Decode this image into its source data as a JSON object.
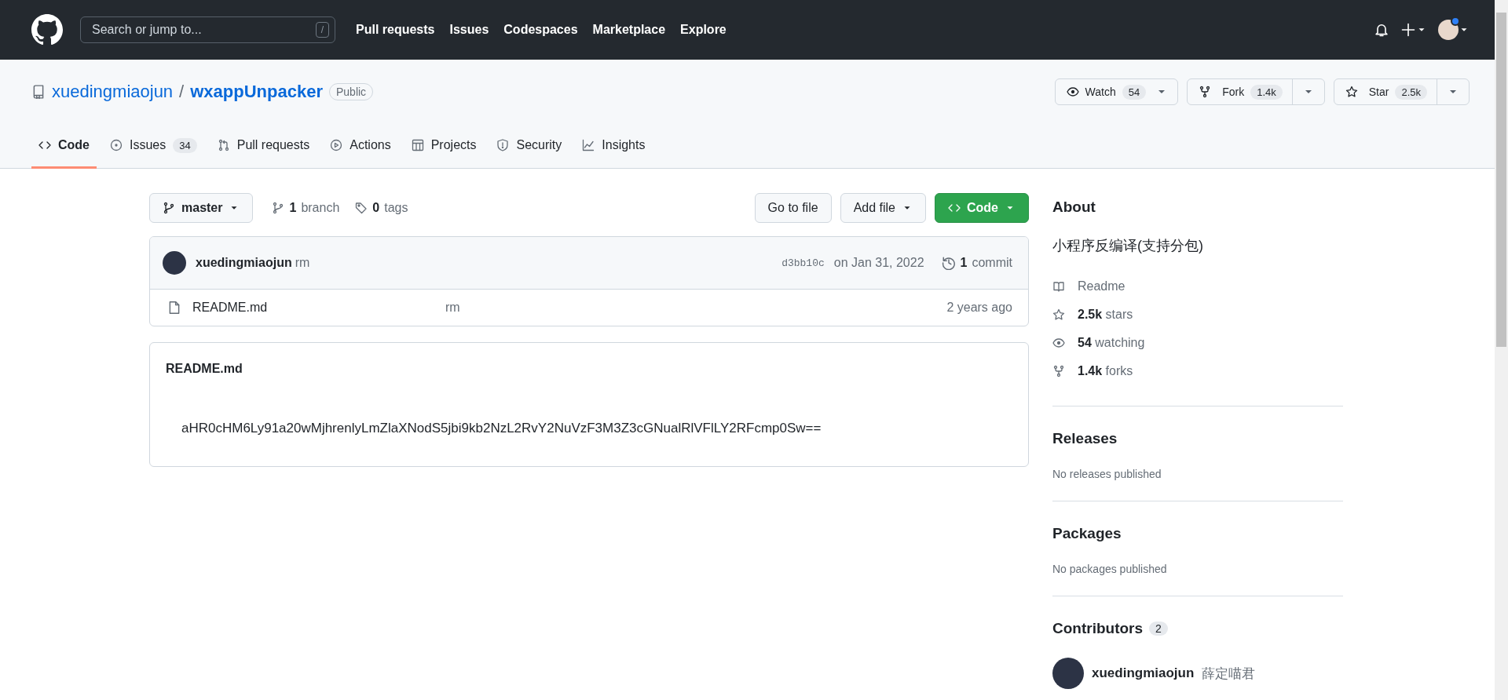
{
  "header": {
    "search": {
      "placeholder": "Search or jump to...",
      "shortcut": "/"
    },
    "nav": [
      "Pull requests",
      "Issues",
      "Codespaces",
      "Marketplace",
      "Explore"
    ]
  },
  "repo": {
    "owner": "xuedingmiaojun",
    "separator": "/",
    "name": "wxappUnpacker",
    "visibility": "Public",
    "actions": [
      {
        "kind": "watch",
        "label": "Watch",
        "count": "54"
      },
      {
        "kind": "fork",
        "label": "Fork",
        "count": "1.4k"
      },
      {
        "kind": "star",
        "label": "Star",
        "count": "2.5k"
      }
    ],
    "tabs": [
      {
        "kind": "code",
        "label": "Code",
        "selected": true
      },
      {
        "kind": "issues",
        "label": "Issues",
        "counter": "34",
        "selected": false
      },
      {
        "kind": "pulls",
        "label": "Pull requests",
        "selected": false
      },
      {
        "kind": "actions",
        "label": "Actions",
        "selected": false
      },
      {
        "kind": "projects",
        "label": "Projects",
        "selected": false
      },
      {
        "kind": "security",
        "label": "Security",
        "selected": false
      },
      {
        "kind": "insights",
        "label": "Insights",
        "selected": false
      }
    ]
  },
  "toolbar": {
    "branch": "master",
    "branches_count": "1",
    "branches_label": "branch",
    "tags_count": "0",
    "tags_label": "tags",
    "buttons": [
      {
        "kind": "plain",
        "label": "Go to file"
      },
      {
        "kind": "menu",
        "label": "Add file"
      },
      {
        "kind": "primary",
        "label": "Code"
      }
    ]
  },
  "commit": {
    "author": "xuedingmiaojun",
    "message": "rm",
    "hash": "d3bb10c",
    "date": "on Jan 31, 2022",
    "count": "1",
    "count_label": "commit"
  },
  "files": [
    {
      "kind": "file",
      "name": "README.md",
      "message": "rm",
      "age": "2 years ago"
    }
  ],
  "readme": {
    "title": "README.md",
    "text": "aHR0cHM6Ly91a20wMjhrenlyLmZlaXNodS5jbi9kb2NzL2RvY2NuVzF3M3Z3cGNualRlVFlLY2RFcmp0Sw=="
  },
  "about": {
    "title": "About",
    "description": "小程序反编译(支持分包)",
    "stats": [
      {
        "kind": "readme",
        "label": "Readme"
      },
      {
        "kind": "stars",
        "count": "2.5k",
        "label": "stars"
      },
      {
        "kind": "watching",
        "count": "54",
        "label": "watching"
      },
      {
        "kind": "forks",
        "count": "1.4k",
        "label": "forks"
      }
    ]
  },
  "releases": {
    "title": "Releases",
    "text": "No releases published"
  },
  "packages": {
    "title": "Packages",
    "text": "No packages published"
  },
  "contributors": {
    "title": "Contributors",
    "count": "2",
    "people": [
      {
        "login": "xuedingmiaojun",
        "name": "薛定喵君"
      }
    ]
  }
}
